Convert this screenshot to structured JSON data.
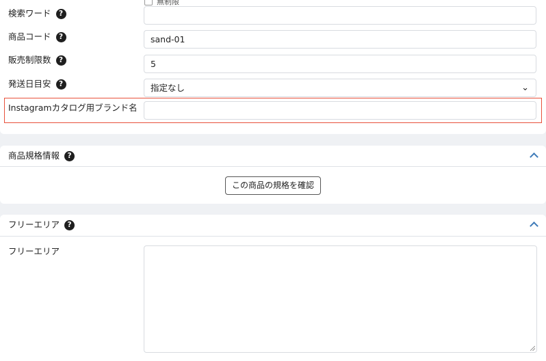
{
  "basic": {
    "partial_checkbox_label": "無制限",
    "fields": [
      {
        "label": "検索ワード",
        "value": ""
      },
      {
        "label": "商品コード",
        "value": "sand-01"
      },
      {
        "label": "販売制限数",
        "value": "5"
      },
      {
        "label": "発送日目安",
        "value": "指定なし"
      },
      {
        "label": "Instagramカタログ用ブランド名",
        "value": ""
      }
    ],
    "help_glyph": "?"
  },
  "spec_section": {
    "title": "商品規格情報",
    "button_label": "この商品の規格を確認"
  },
  "free_section": {
    "title": "フリーエリア",
    "field_label": "フリーエリア",
    "value": ""
  },
  "icons": {
    "help": "question-circle-icon",
    "collapse": "chevron-up-icon",
    "dropdown": "chevron-down-icon"
  },
  "colors": {
    "highlight": "#e8503a",
    "accent": "#3d7ab8"
  }
}
